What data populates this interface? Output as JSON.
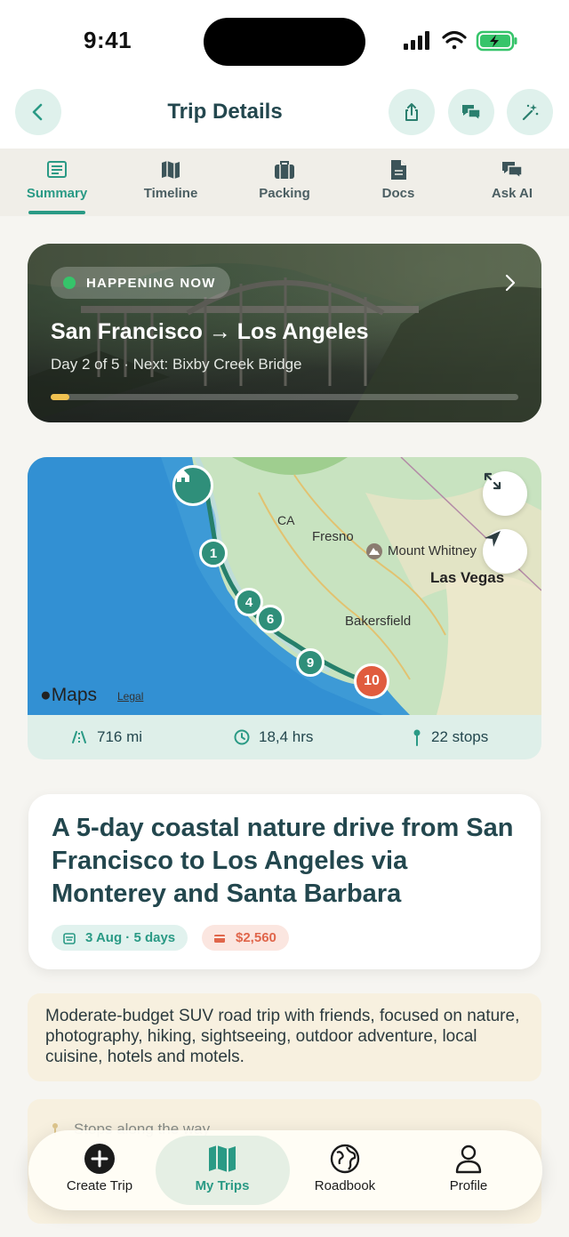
{
  "status": {
    "time": "9:41"
  },
  "header": {
    "title": "Trip Details"
  },
  "tabs": [
    {
      "label": "Summary",
      "icon": "summary-icon",
      "active": true
    },
    {
      "label": "Timeline",
      "icon": "map-icon"
    },
    {
      "label": "Packing",
      "icon": "suitcase-icon"
    },
    {
      "label": "Docs",
      "icon": "document-icon"
    },
    {
      "label": "Ask AI",
      "icon": "chat-icon"
    }
  ],
  "hero": {
    "badge": "HAPPENING NOW",
    "route": "San Francisco → Los Angeles",
    "subtitle": "Day 2 of 5  ·  Next: Bixby Creek Bridge",
    "progress": 0.04
  },
  "map": {
    "labels": {
      "state": "CA",
      "fresno": "Fresno",
      "whitney": "Mount Whitney",
      "lasvegas": "Las Vegas",
      "bakersfield": "Bakersfield"
    },
    "pins": {
      "p1": "1",
      "p4": "4",
      "p6": "6",
      "p9": "9",
      "p10": "10"
    },
    "brand": "Maps",
    "legal": "Legal"
  },
  "stats": {
    "distance": "716 mi",
    "duration": "18,4 hrs",
    "stops": "22 stops"
  },
  "summary": {
    "title": "A 5-day coastal nature drive from San Francisco to Los Angeles via Monterey and Santa Barbara",
    "date": "3 Aug · 5 days",
    "budget": "$2,560"
  },
  "description": "Moderate-budget SUV road trip with friends, focused on nature, photography, hiking, sightseeing, outdoor adventure, local cuisine, hotels and motels.",
  "stops_section": {
    "title": "Stops along the way"
  },
  "tabbar": {
    "create": "Create Trip",
    "mytrips": "My Trips",
    "roadbook": "Roadbook",
    "profile": "Profile"
  },
  "colors": {
    "accent": "#2a9a85",
    "budget": "#e0664b",
    "live": "#36c46a",
    "progress": "#f0c150"
  }
}
